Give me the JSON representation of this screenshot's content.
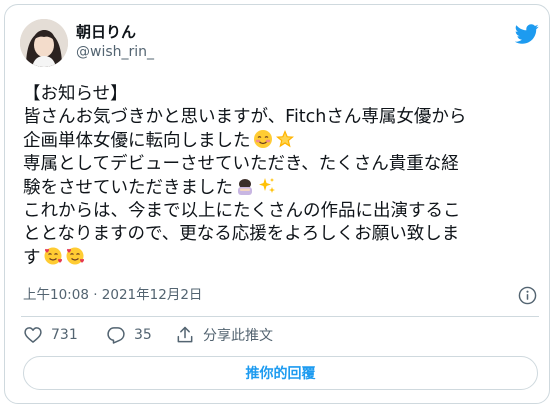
{
  "author": {
    "display_name": "朝日りん",
    "handle": "@wish_rin_"
  },
  "tweet": {
    "lines": [
      "【お知らせ】",
      "皆さんお気づきかと思いますが、Fitchさん専属女優から",
      "企画単体女優に転向しました",
      "専属としてデビューさせていただき、たくさん貴重な経",
      "験をさせていただきました",
      "これからは、今まで以上にたくさんの作品に出演するこ",
      "ととなりますので、更なる応援をよろしくお願い致しま",
      "す"
    ],
    "emojis": [
      {
        "line": 2,
        "names": [
          "smiling-face-with-blush",
          "glowing-star"
        ]
      },
      {
        "line": 4,
        "names": [
          "person-bowing",
          "sparkles"
        ]
      },
      {
        "line": 7,
        "names": [
          "smiling-face-with-hearts",
          "smiling-face-with-hearts"
        ]
      }
    ],
    "timestamp": "上午10:08 · 2021年12月2日"
  },
  "actions": {
    "likes": "731",
    "replies": "35",
    "share_label": "分享此推文"
  },
  "reply_button_label": "推你的回覆",
  "colors": {
    "accent": "#1d9bf0",
    "secondary_text": "#536471",
    "border": "#cfd9de",
    "primary_text": "#0f1419"
  },
  "icons": [
    "twitter-bird-icon",
    "info-icon",
    "heart-icon",
    "reply-icon",
    "share-icon"
  ]
}
